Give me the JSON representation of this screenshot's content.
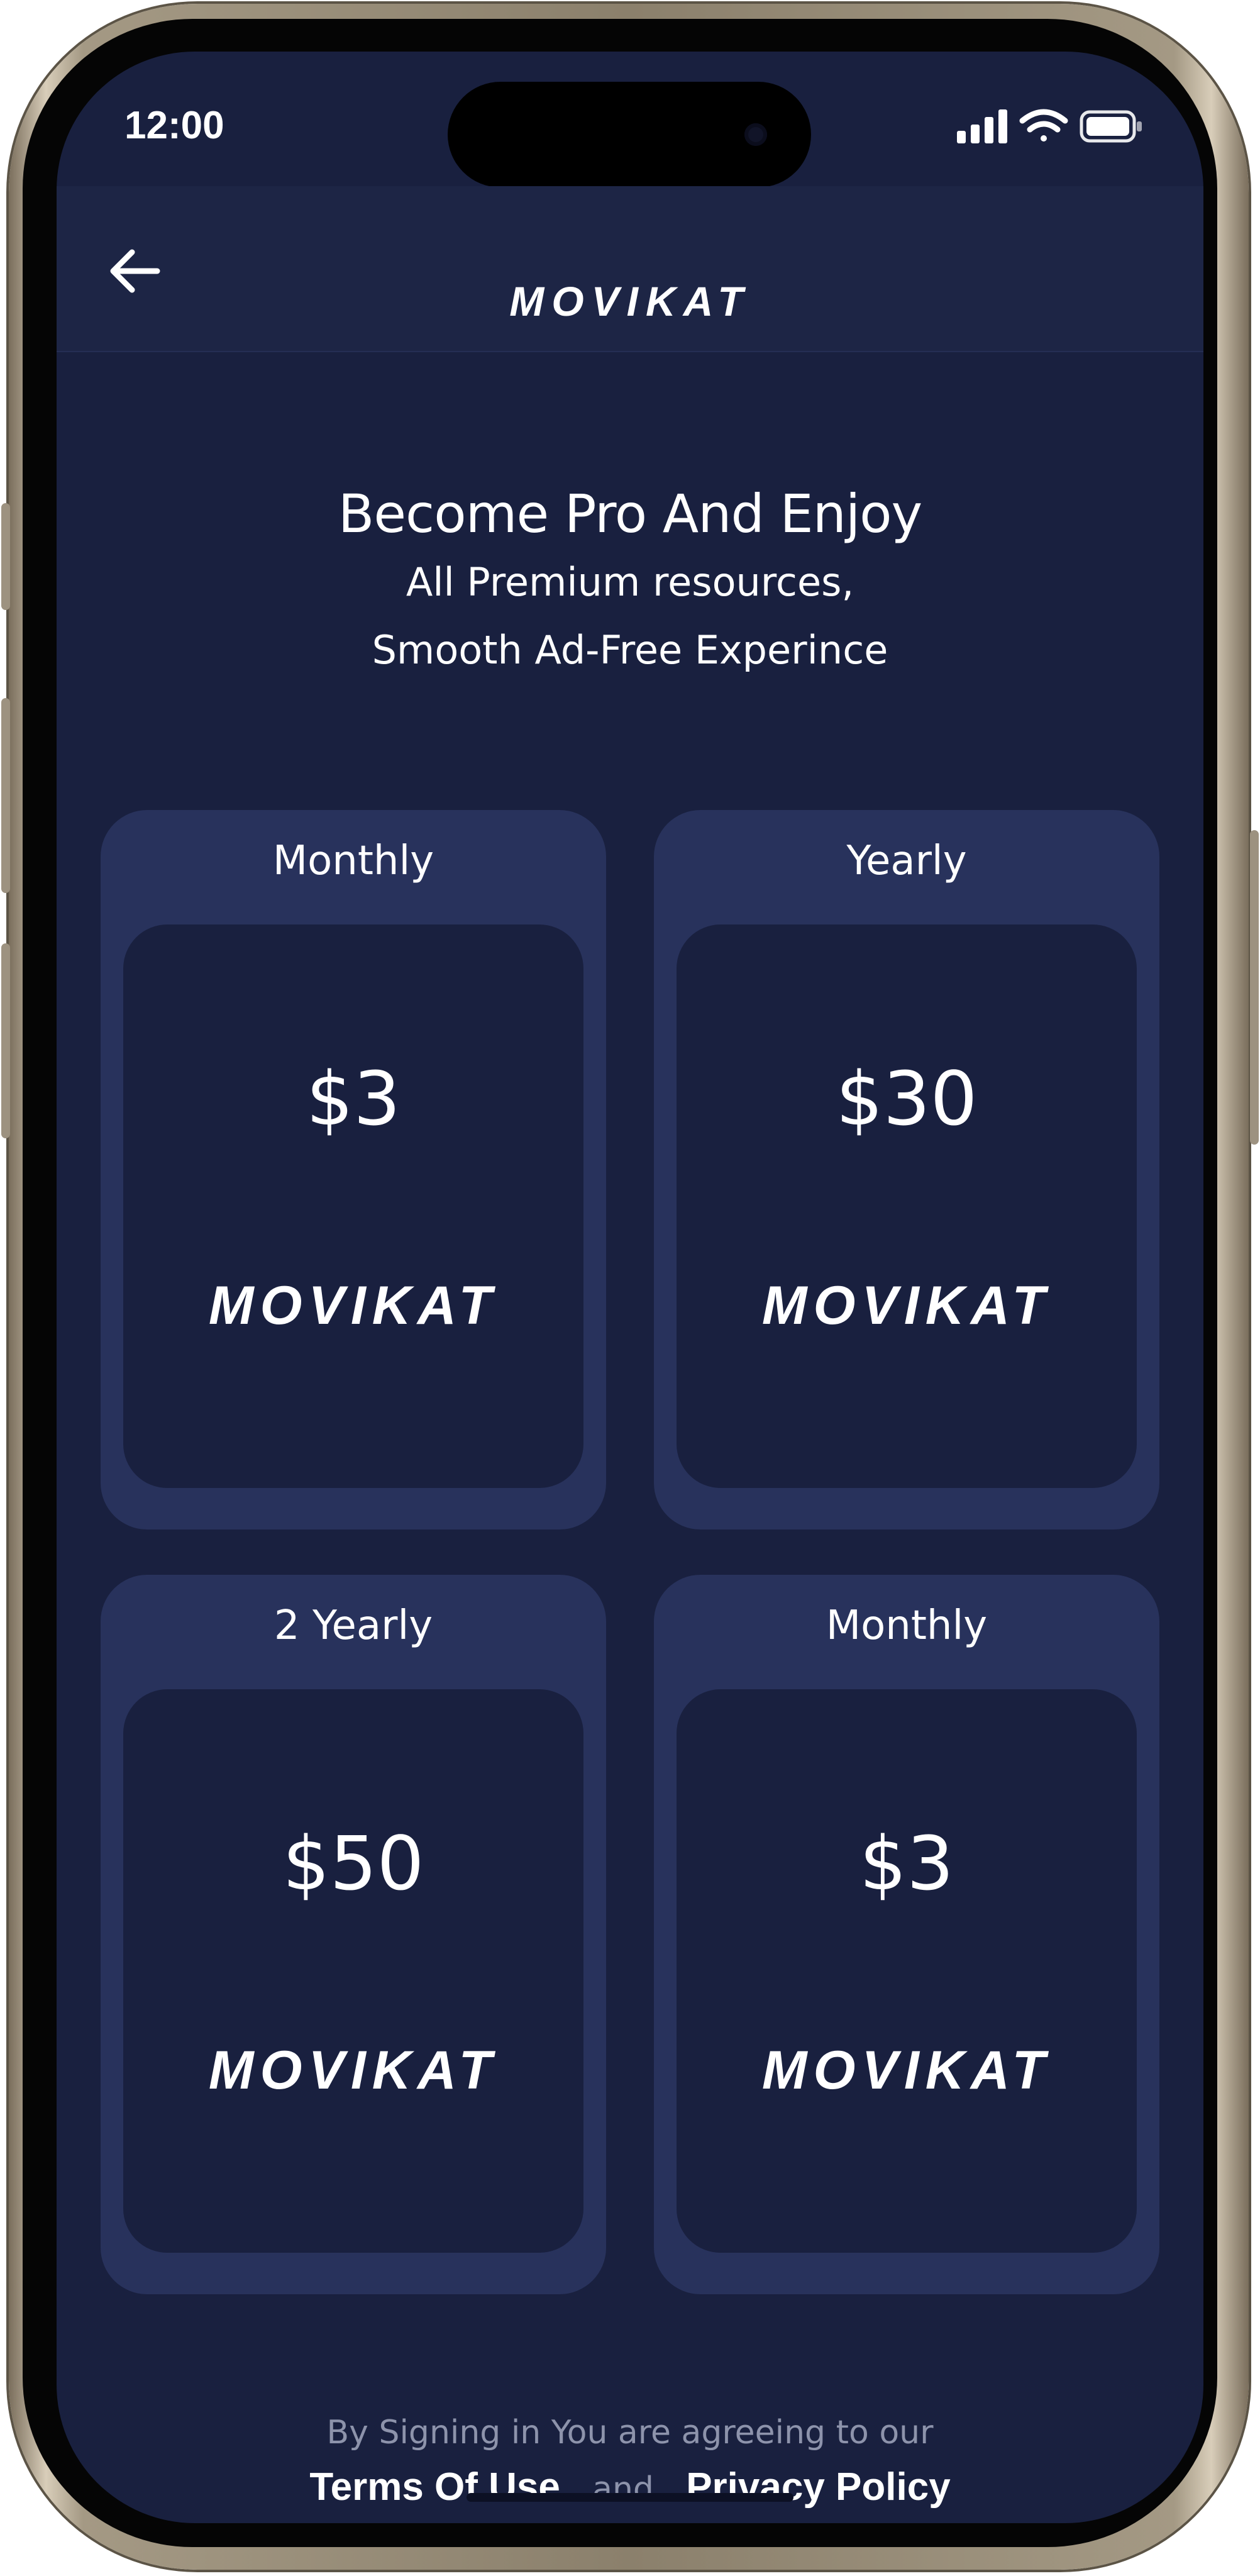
{
  "status_bar": {
    "time": "12:00",
    "icons": [
      "cellular-signal-icon",
      "wifi-icon",
      "battery-icon"
    ]
  },
  "header": {
    "back_icon": "arrow-left-icon",
    "logo_text": "MOVIKAT"
  },
  "promo": {
    "title": "Become Pro And Enjoy",
    "line1": "All Premium resources,",
    "line2": "Smooth Ad-Free Experince"
  },
  "plans": [
    {
      "label": "Monthly",
      "price": "$3",
      "logo_text": "MOVIKAT"
    },
    {
      "label": "Yearly",
      "price": "$30",
      "logo_text": "MOVIKAT"
    },
    {
      "label": "2 Yearly",
      "price": "$50",
      "logo_text": "MOVIKAT"
    },
    {
      "label": "Monthly",
      "price": "$3",
      "logo_text": "MOVIKAT"
    }
  ],
  "footer": {
    "agree_text": "By Signing in You are agreeing to our",
    "terms_label": "Terms Of Use",
    "and_text": "and",
    "privacy_label": "Privacy Policy"
  },
  "colors": {
    "screen_bg": "#19203f",
    "card_bg": "#28325c",
    "header_bg": "#1d2545",
    "logo_gradient": [
      "#f6c453",
      "#f07a3f",
      "#e0384f"
    ]
  }
}
